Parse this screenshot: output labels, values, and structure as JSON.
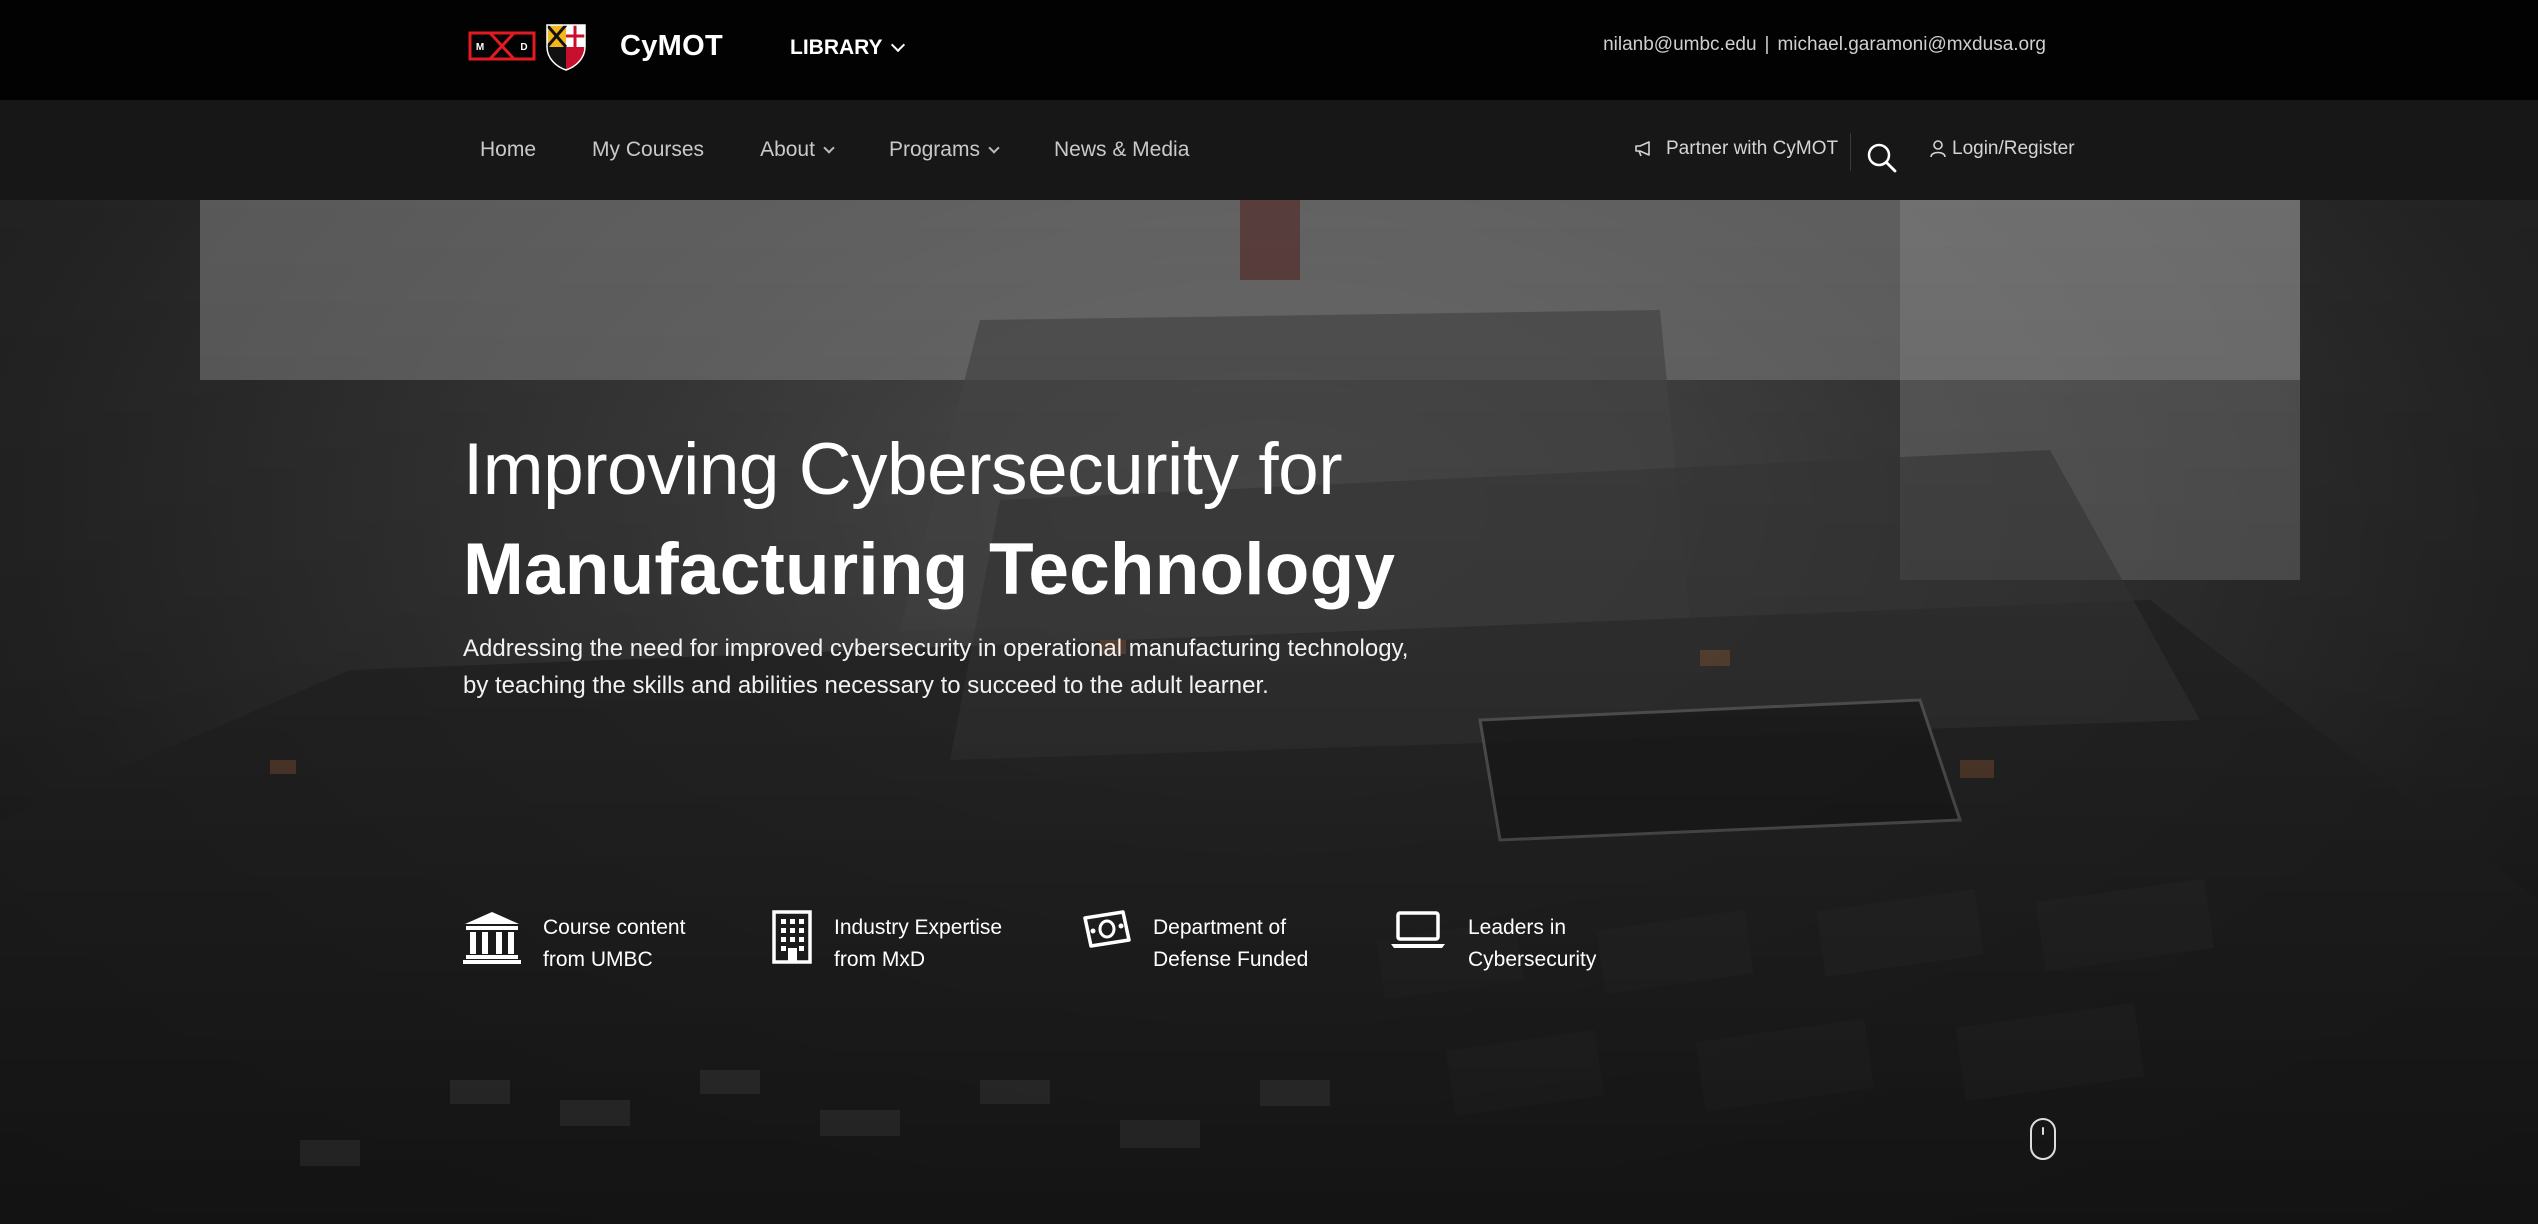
{
  "topbar": {
    "logo_text": "M D",
    "brand": "CyMOT",
    "library_label": "LIBRARY",
    "contact_email_1": "nilanb@umbc.edu",
    "contact_separator": "|",
    "contact_email_2": "michael.garamoni@mxdusa.org"
  },
  "nav": {
    "items": [
      {
        "label": "Home"
      },
      {
        "label": "My Courses"
      },
      {
        "label": "About"
      },
      {
        "label": "Programs"
      },
      {
        "label": "News & Media"
      }
    ],
    "partner_label": "Partner with CyMOT",
    "login_label": "Login/Register"
  },
  "hero": {
    "title_line1": "Improving Cybersecurity for",
    "title_line2": "Manufacturing Technology",
    "subtitle": "Addressing the need for improved cybersecurity in operational manufacturing technology, by teaching the skills and abilities necessary to succeed to the adult learner."
  },
  "features": [
    {
      "line1": "Course content",
      "line2": "from UMBC",
      "icon": "institution-icon"
    },
    {
      "line1": "Industry Expertise",
      "line2": "from MxD",
      "icon": "building-icon"
    },
    {
      "line1": "Department of",
      "line2": "Defense Funded",
      "icon": "money-icon"
    },
    {
      "line1": "Leaders in",
      "line2": "Cybersecurity",
      "icon": "laptop-icon"
    }
  ],
  "colors": {
    "mxd_red": "#e21b23",
    "shield_gold": "#f2b81a",
    "shield_red": "#c8102e"
  }
}
